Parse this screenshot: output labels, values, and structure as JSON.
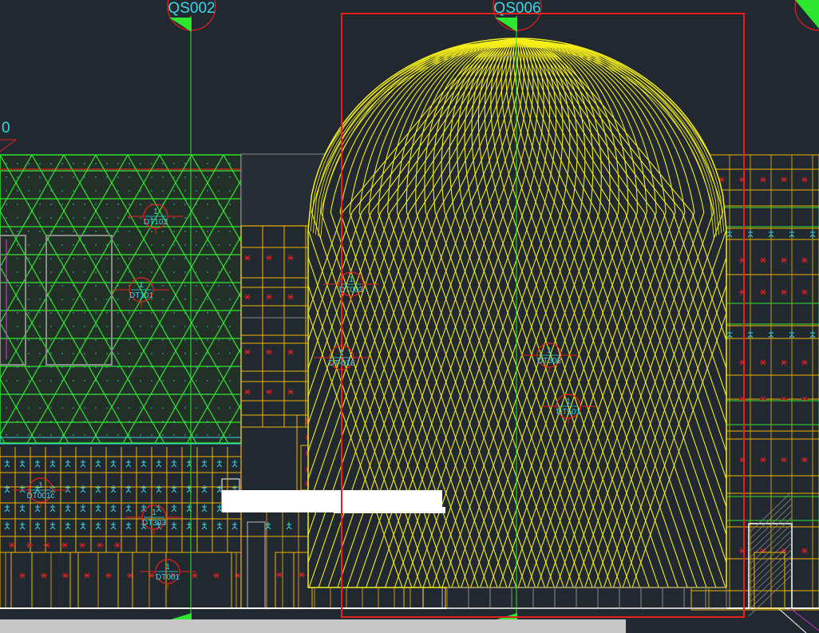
{
  "grid_labels": [
    {
      "id": "left",
      "text": "QS002"
    },
    {
      "id": "center",
      "text": "QS006"
    },
    {
      "id": "edge",
      "text": "0"
    }
  ],
  "tags": [
    {
      "num": "1",
      "code": "DT103"
    },
    {
      "num": "1",
      "code": "DT101"
    },
    {
      "num": "1",
      "code": "DT003"
    },
    {
      "num": "1",
      "code": "DT-016"
    },
    {
      "num": "1",
      "code": "DT502"
    },
    {
      "num": "1",
      "code": "DT501"
    },
    {
      "num": "1",
      "code": "DT001c"
    },
    {
      "num": "1",
      "code": "DT303"
    },
    {
      "num": "1",
      "code": "DT001"
    }
  ],
  "colors": {
    "background": "#212830",
    "facade_yellow": "#f0b400",
    "dome_yellow": "#f5ee1a",
    "mesh_green": "#2ee62e",
    "cyan": "#3bd6e8",
    "red": "#e82020",
    "selection_frame": "#e82020",
    "white": "#ffffff",
    "gray": "#8a8a8a",
    "magenta": "#d030d0"
  }
}
